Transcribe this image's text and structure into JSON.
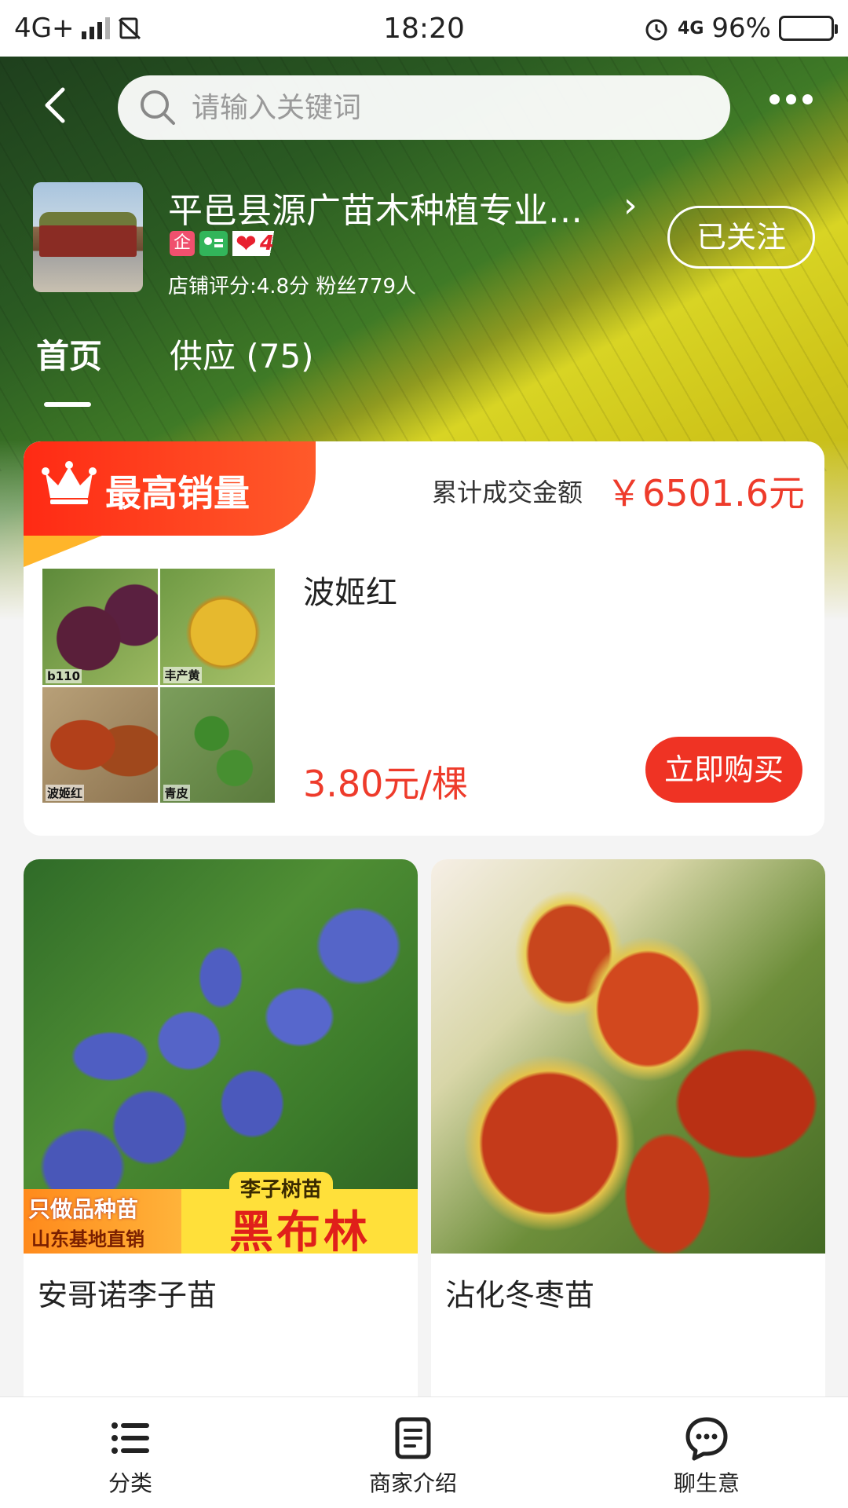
{
  "status_bar": {
    "network": "4G+",
    "time": "18:20",
    "network2": "4G",
    "battery": "96%"
  },
  "search": {
    "placeholder": "请输入关键词"
  },
  "shop": {
    "name": "平邑县源广苗木种植专业…",
    "ent_badge": "企",
    "level": "4",
    "stats": "店铺评分:4.8分 粉丝779人",
    "follow_label": "已关注"
  },
  "tabs": [
    {
      "label": "首页",
      "active": true
    },
    {
      "label": "供应 (75)",
      "active": false
    }
  ],
  "top_sales": {
    "title": "最高销量",
    "total_label": "累计成交金额",
    "total_value": "￥6501.6元",
    "product": {
      "name": "波姬红",
      "price": "3.80元/棵",
      "buy_label": "立即购买",
      "thumb_labels": [
        "b110",
        "丰产黄",
        "波姬红",
        "青皮"
      ]
    }
  },
  "products": [
    {
      "title": "安哥诺李子苗",
      "banner": {
        "line1": "只做品种苗",
        "line2": "山东基地直销",
        "tag": "李子树苗",
        "headline": "黑布林"
      }
    },
    {
      "title": "沾化冬枣苗"
    }
  ],
  "bottom_nav": [
    {
      "label": "分类",
      "icon": "list-icon"
    },
    {
      "label": "商家介绍",
      "icon": "document-icon"
    },
    {
      "label": "聊生意",
      "icon": "chat-icon"
    }
  ],
  "colors": {
    "accent": "#ee3b2b",
    "ribbon": "#ff2a14"
  }
}
